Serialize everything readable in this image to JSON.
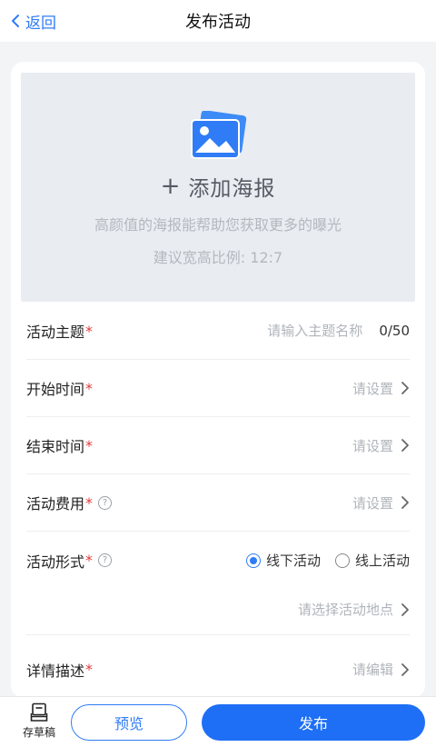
{
  "nav": {
    "back_label": "返回",
    "title": "发布活动"
  },
  "poster": {
    "icon": "image-icon",
    "add_label": "添加海报",
    "tip": "高颜值的海报能帮助您获取更多的曝光",
    "ratio": "建议宽高比例: 12:7"
  },
  "fields": {
    "theme": {
      "label": "活动主题",
      "required": "*",
      "placeholder": "请输入主题名称",
      "counter": "0/50"
    },
    "start": {
      "label": "开始时间",
      "required": "*",
      "value": "请设置"
    },
    "end": {
      "label": "结束时间",
      "required": "*",
      "value": "请设置"
    },
    "fee": {
      "label": "活动费用",
      "required": "*",
      "help": "?",
      "value": "请设置"
    },
    "format": {
      "label": "活动形式",
      "required": "*",
      "help": "?",
      "options": [
        "线下活动",
        "线上活动"
      ],
      "selected": "线下活动",
      "location_placeholder": "请选择活动地点"
    },
    "detail": {
      "label": "详情描述",
      "required": "*",
      "value": "请编辑"
    }
  },
  "bottom": {
    "draft_label": "存草稿",
    "preview_label": "预览",
    "publish_label": "发布"
  },
  "colors": {
    "accent": "#2f7cf6",
    "required": "#e23b3b",
    "publish_bg": "#1e6ff5"
  }
}
